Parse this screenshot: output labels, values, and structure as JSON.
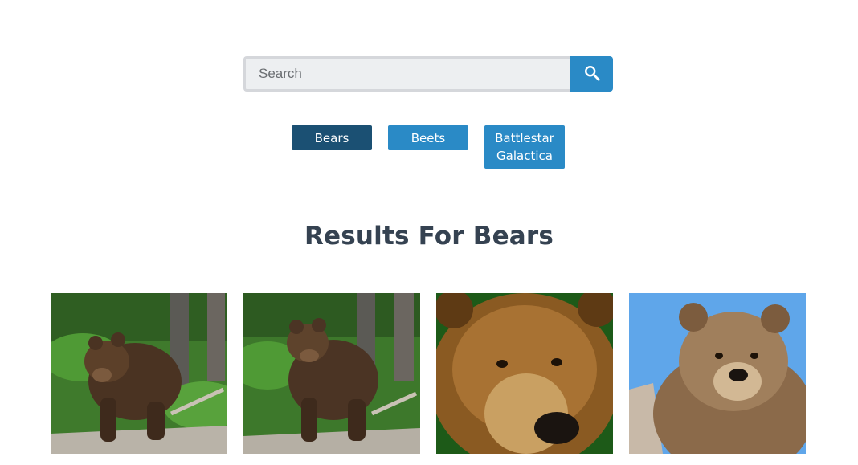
{
  "search": {
    "placeholder": "Search",
    "value": "",
    "button_icon": "search-icon"
  },
  "topics": [
    {
      "label": "Bears",
      "active": true
    },
    {
      "label": "Beets",
      "active": false
    },
    {
      "label": "Battlestar Galactica",
      "active": false
    }
  ],
  "results": {
    "heading": "Results For Bears"
  },
  "colors": {
    "primary": "#2a8ac6",
    "primary_active": "#1b5073",
    "heading": "#354251",
    "input_bg": "#edeff1"
  }
}
